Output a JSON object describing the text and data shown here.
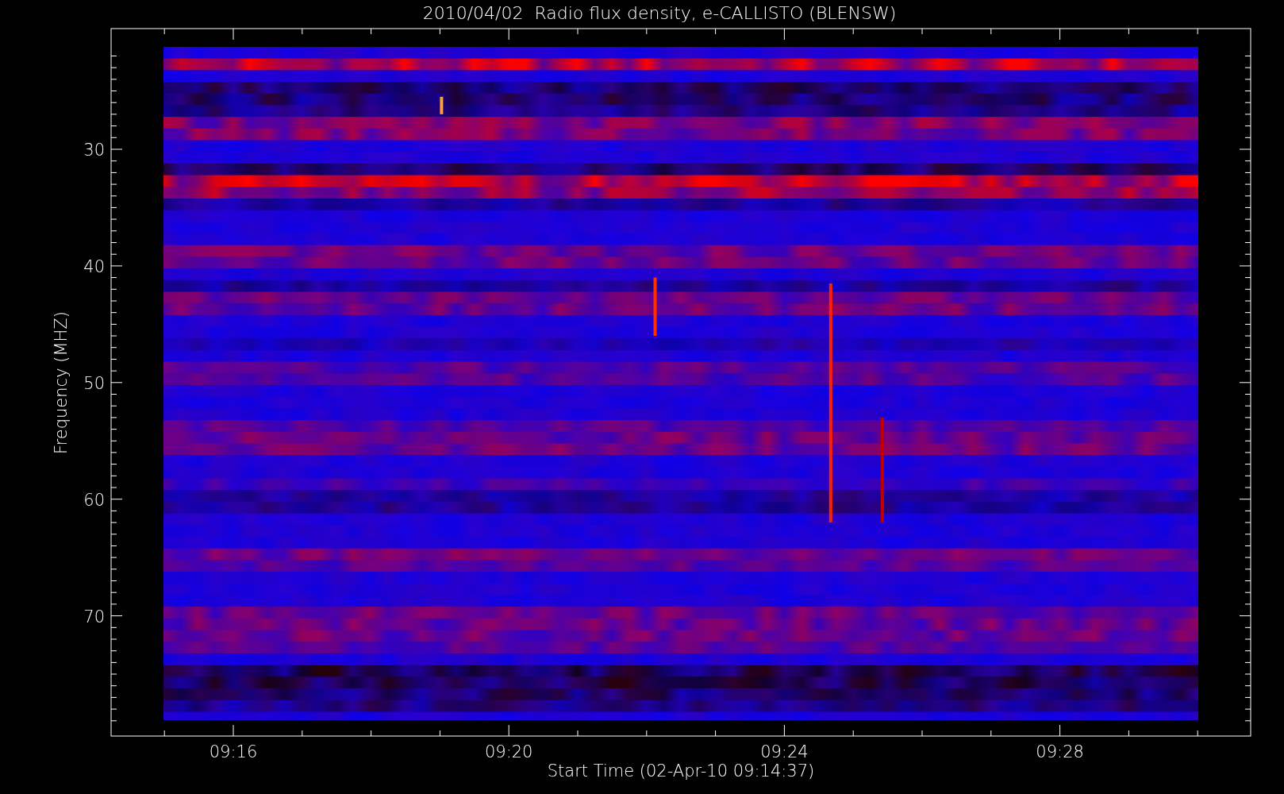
{
  "plot": {
    "title": "2010/04/02  Radio flux density, e-CALLISTO (BLENSW)",
    "ylabel": "Frequency (MHZ)",
    "xlabel": "Start Time (02-Apr-10 09:14:37)",
    "yticks": [
      "30",
      "40",
      "50",
      "60",
      "70"
    ],
    "xticks": [
      "09:16",
      "09:20",
      "09:24",
      "09:28"
    ]
  }
}
